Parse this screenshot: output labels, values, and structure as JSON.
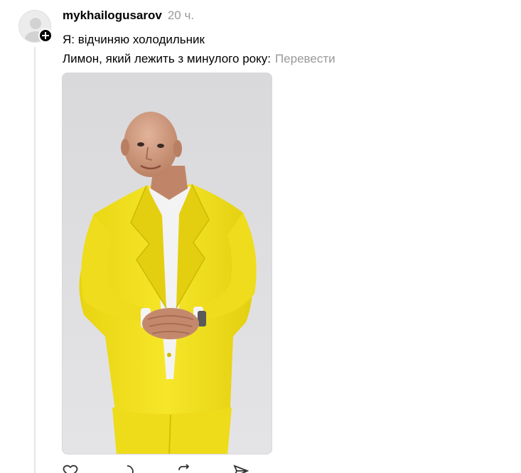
{
  "post": {
    "username": "mykhailogusarov",
    "timestamp": "20 ч.",
    "lines": [
      "Я: відчиняю холодильник",
      "Лимон, який лежить з минулого року:"
    ],
    "translate_label": "Перевести"
  },
  "media": {
    "subject": "man in bright yellow suit with white shirt, bald head, hands clasped, light grey background",
    "colors": {
      "suit": "#f2e21c",
      "background": "#d5d5d7",
      "shirt": "#f4f4f4",
      "skin": "#c99476"
    }
  },
  "actions": [
    "heart-icon",
    "comment-icon",
    "repost-icon",
    "share-icon"
  ]
}
